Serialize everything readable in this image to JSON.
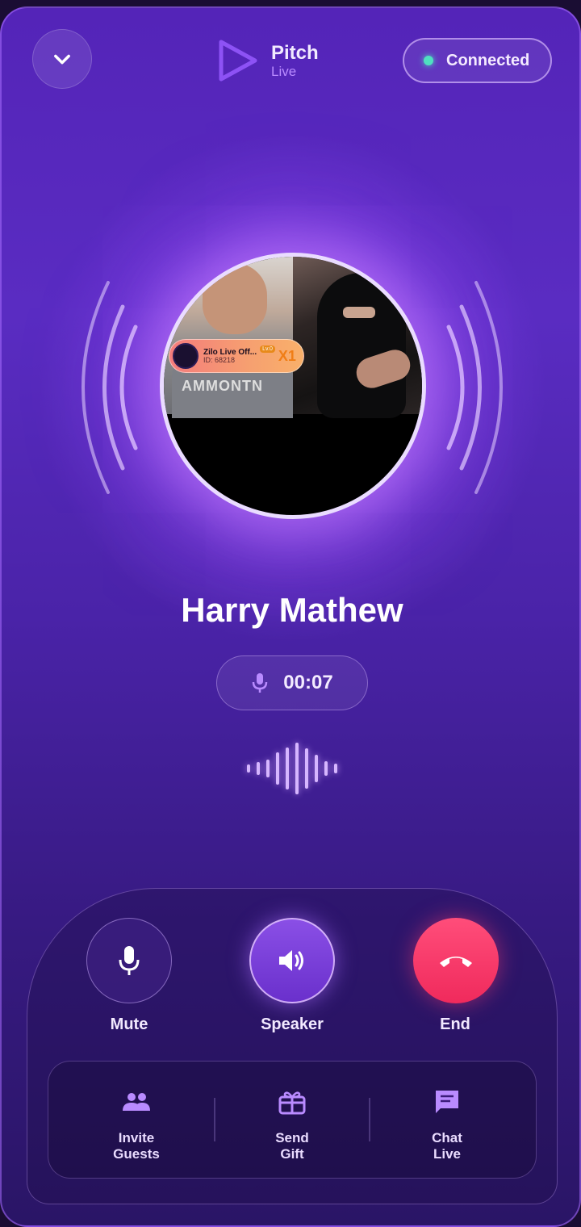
{
  "header": {
    "app_title": "Pitch",
    "app_subtitle": "Live",
    "status_label": "Connected"
  },
  "video": {
    "badge_name": "Zilo Live Off...",
    "badge_id": "ID: 68218",
    "badge_level": "Lv.0",
    "badge_multiplier": "X1",
    "shirt_text": "AMMONTN"
  },
  "call": {
    "caller_name": "Harry Mathew",
    "timer": "00:07"
  },
  "controls": {
    "mute_label": "Mute",
    "speaker_label": "Speaker",
    "end_label": "End"
  },
  "actions": {
    "invite_line1": "Invite",
    "invite_line2": "Guests",
    "gift_line1": "Send",
    "gift_line2": "Gift",
    "chat_line1": "Chat",
    "chat_line2": "Live"
  },
  "colors": {
    "accent": "#8a4fe6",
    "end_call": "#f02a5c",
    "status_dot": "#4fe0c0"
  }
}
